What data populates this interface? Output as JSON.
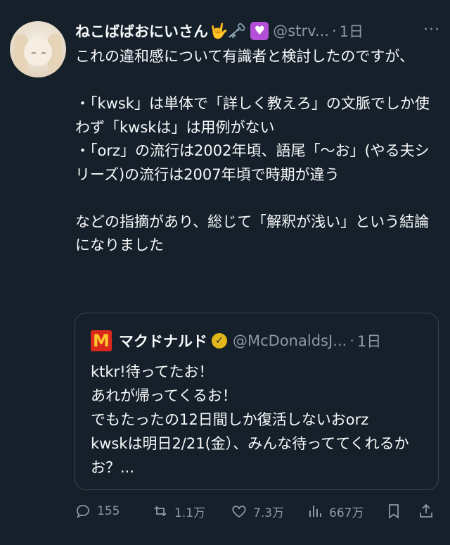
{
  "tweet": {
    "display_name": "ねこばばおにいさん",
    "name_emojis": "🤟🗝️",
    "heart_emoji": "💟",
    "handle": "@strv...",
    "separator": "·",
    "time": "1日",
    "more": "···",
    "text": "これの違和感について有識者と検討したのですが、\n\n・「kwsk」は単体で「詳しく教えろ」の文脈でしか使わず「kwskは」は用例がない\n・「orz」の流行は2002年頃、語尾「〜お」(やる夫シリーズ)の流行は2007年頃で時期が違う\n\nなどの指摘があり、総じて「解釈が浅い」という結論になりました"
  },
  "quote": {
    "logo": "M",
    "display_name": "マクドナルド",
    "verified_icon": "✓",
    "handle": "@McDonaldsJ...",
    "separator": "·",
    "time": "1日",
    "text": "ktkr!待ってたお！\nあれが帰ってくるお！\nでもたったの12日間しか復活しないおorz\nkwskは明日2/21(金）、みんな待っててくれるかお？..."
  },
  "actions": {
    "reply_count": "155",
    "retweet_count": "1.1万",
    "like_count": "7.3万",
    "view_count": "667万"
  },
  "colors": {
    "background": "#15202b",
    "text": "#f7f9f9",
    "muted": "#8b98a5",
    "border": "#38444d",
    "mcdonalds_red": "#da291c",
    "mcdonalds_yellow": "#ffc72c"
  }
}
